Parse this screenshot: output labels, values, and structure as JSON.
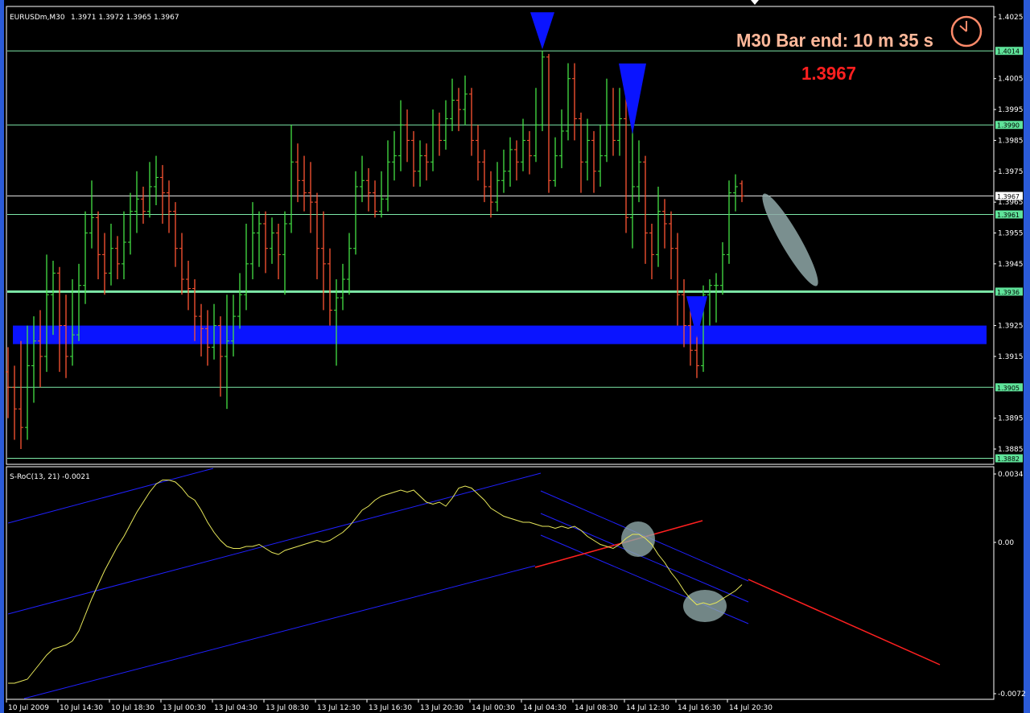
{
  "header": {
    "symbol": "EURUSDm,M30",
    "ohlc": "1.3971 1.3972 1.3965 1.3967"
  },
  "overlay": {
    "bar_end": "M30 Bar end: 10 m 35 s",
    "price": "1.3967",
    "clock_icon": "clock-icon",
    "text_color": "#ffb89a",
    "price_color": "#ff2020"
  },
  "indicator": {
    "label": "S-RoC(13, 21) -0.0021",
    "ticks": [
      "0.0034",
      "0.00",
      "-0.0072"
    ]
  },
  "colors": {
    "up": "#44e244",
    "down": "#ff5533",
    "level": "#7de8a8",
    "current": "#e0e0e0",
    "zone": "#0a14ff",
    "arrow": "#0a14ff",
    "indicator_line": "#e8e85a",
    "channel": "#2020ff",
    "trend_red": "#ff2020"
  },
  "chart_data": [
    {
      "type": "ohlc-bar",
      "symbol": "EURUSDm",
      "timeframe": "M30",
      "ylim": [
        1.388,
        1.403
      ],
      "price_ticks": [
        "1.4025",
        "1.4005",
        "1.3995",
        "1.3985",
        "1.3975",
        "1.3965",
        "1.3955",
        "1.3945",
        "1.3925",
        "1.3915",
        "1.3895",
        "1.3885"
      ],
      "x_tick_labels": [
        "10 Jul 2009",
        "10 Jul 14:30",
        "10 Jul 18:30",
        "13 Jul 00:30",
        "13 Jul 04:30",
        "13 Jul 08:30",
        "13 Jul 12:30",
        "13 Jul 16:30",
        "13 Jul 20:30",
        "14 Jul 00:30",
        "14 Jul 04:30",
        "14 Jul 08:30",
        "14 Jul 12:30",
        "14 Jul 16:30",
        "14 Jul 20:30"
      ],
      "levels": [
        {
          "price": "1.4014",
          "kind": "level"
        },
        {
          "price": "1.3990",
          "kind": "level"
        },
        {
          "price": "1.3967",
          "kind": "current"
        },
        {
          "price": "1.3961",
          "kind": "level"
        },
        {
          "price": "1.3936",
          "kind": "level-strong"
        },
        {
          "price": "1.3905",
          "kind": "level"
        },
        {
          "price": "1.3882",
          "kind": "level"
        }
      ],
      "zone": [
        1.3919,
        1.3925
      ],
      "down_arrows_at_bar": [
        83,
        97,
        107
      ],
      "bars_ohlc": [
        [
          1.391,
          1.3918,
          1.3895,
          1.3905
        ],
        [
          1.3905,
          1.3912,
          1.3888,
          1.3898
        ],
        [
          1.3898,
          1.392,
          1.3885,
          1.3892
        ],
        [
          1.3892,
          1.3925,
          1.3888,
          1.3912
        ],
        [
          1.3912,
          1.3928,
          1.39,
          1.392
        ],
        [
          1.392,
          1.393,
          1.3905,
          1.3915
        ],
        [
          1.3915,
          1.3948,
          1.391,
          1.3935
        ],
        [
          1.3935,
          1.3946,
          1.3922,
          1.3942
        ],
        [
          1.3942,
          1.3944,
          1.391,
          1.3925
        ],
        [
          1.3925,
          1.3935,
          1.3908,
          1.3915
        ],
        [
          1.3915,
          1.394,
          1.3912,
          1.3922
        ],
        [
          1.3922,
          1.3945,
          1.392,
          1.3938
        ],
        [
          1.3938,
          1.3962,
          1.3932,
          1.3955
        ],
        [
          1.3955,
          1.3972,
          1.395,
          1.396
        ],
        [
          1.396,
          1.3962,
          1.394,
          1.3948
        ],
        [
          1.3948,
          1.3955,
          1.3935,
          1.3942
        ],
        [
          1.3942,
          1.3958,
          1.3938,
          1.395
        ],
        [
          1.395,
          1.3954,
          1.394,
          1.3945
        ],
        [
          1.3945,
          1.3962,
          1.394,
          1.3952
        ],
        [
          1.3952,
          1.3968,
          1.3948,
          1.3962
        ],
        [
          1.3962,
          1.3975,
          1.3955,
          1.3966
        ],
        [
          1.3966,
          1.397,
          1.3958,
          1.3962
        ],
        [
          1.3962,
          1.3978,
          1.396,
          1.397
        ],
        [
          1.397,
          1.398,
          1.3964,
          1.3973
        ],
        [
          1.3973,
          1.3977,
          1.3958,
          1.3968
        ],
        [
          1.3968,
          1.3972,
          1.3955,
          1.3962
        ],
        [
          1.3962,
          1.3965,
          1.3944,
          1.395
        ],
        [
          1.395,
          1.3955,
          1.3935,
          1.394
        ],
        [
          1.394,
          1.3946,
          1.393,
          1.3937
        ],
        [
          1.3937,
          1.394,
          1.392,
          1.3928
        ],
        [
          1.3928,
          1.3932,
          1.3915,
          1.3924
        ],
        [
          1.3924,
          1.393,
          1.3912,
          1.3918
        ],
        [
          1.3918,
          1.3932,
          1.3914,
          1.3925
        ],
        [
          1.3925,
          1.3928,
          1.3902,
          1.3915
        ],
        [
          1.3915,
          1.3935,
          1.3898,
          1.392
        ],
        [
          1.392,
          1.3935,
          1.3915,
          1.3928
        ],
        [
          1.3928,
          1.3942,
          1.3924,
          1.3935
        ],
        [
          1.3935,
          1.3958,
          1.393,
          1.3945
        ],
        [
          1.3945,
          1.3965,
          1.394,
          1.3955
        ],
        [
          1.3955,
          1.3962,
          1.3944,
          1.3958
        ],
        [
          1.3958,
          1.3962,
          1.3942,
          1.395
        ],
        [
          1.395,
          1.396,
          1.3945,
          1.3955
        ],
        [
          1.3955,
          1.3958,
          1.394,
          1.3948
        ],
        [
          1.3948,
          1.3962,
          1.3935,
          1.3958
        ],
        [
          1.3958,
          1.399,
          1.3955,
          1.3978
        ],
        [
          1.3978,
          1.3984,
          1.3965,
          1.3972
        ],
        [
          1.3972,
          1.398,
          1.3962,
          1.3968
        ],
        [
          1.3968,
          1.3978,
          1.3955,
          1.3965
        ],
        [
          1.3965,
          1.3968,
          1.394,
          1.395
        ],
        [
          1.395,
          1.3962,
          1.393,
          1.3945
        ],
        [
          1.3945,
          1.395,
          1.3925,
          1.393
        ],
        [
          1.393,
          1.394,
          1.3912,
          1.3934
        ],
        [
          1.3934,
          1.3945,
          1.393,
          1.394
        ],
        [
          1.394,
          1.3955,
          1.3935,
          1.395
        ],
        [
          1.395,
          1.3975,
          1.3948,
          1.397
        ],
        [
          1.397,
          1.398,
          1.3965,
          1.3972
        ],
        [
          1.3972,
          1.3976,
          1.3962,
          1.3968
        ],
        [
          1.3968,
          1.3972,
          1.396,
          1.3962
        ],
        [
          1.3962,
          1.3975,
          1.396,
          1.3966
        ],
        [
          1.3966,
          1.3985,
          1.3962,
          1.3978
        ],
        [
          1.3978,
          1.3988,
          1.3972,
          1.398
        ],
        [
          1.398,
          1.3998,
          1.3975,
          1.399
        ],
        [
          1.399,
          1.3995,
          1.3978,
          1.3985
        ],
        [
          1.3985,
          1.3988,
          1.397,
          1.3975
        ],
        [
          1.3975,
          1.3985,
          1.397,
          1.398
        ],
        [
          1.398,
          1.3984,
          1.3972,
          1.3978
        ],
        [
          1.3978,
          1.3995,
          1.3975,
          1.399
        ],
        [
          1.399,
          1.3994,
          1.398,
          1.3985
        ],
        [
          1.3985,
          1.3998,
          1.3982,
          1.3992
        ],
        [
          1.3992,
          1.4005,
          1.3988,
          1.3998
        ],
        [
          1.3998,
          1.4002,
          1.3988,
          1.3995
        ],
        [
          1.3995,
          1.4006,
          1.399,
          1.4
        ],
        [
          1.4,
          1.4002,
          1.398,
          1.3985
        ],
        [
          1.3985,
          1.399,
          1.3972,
          1.3978
        ],
        [
          1.3978,
          1.3982,
          1.3965,
          1.397
        ],
        [
          1.397,
          1.3975,
          1.396,
          1.3965
        ],
        [
          1.3965,
          1.3978,
          1.3962,
          1.3972
        ],
        [
          1.3972,
          1.3982,
          1.3968,
          1.3975
        ],
        [
          1.3975,
          1.3986,
          1.397,
          1.3982
        ],
        [
          1.3982,
          1.3985,
          1.3972,
          1.3978
        ],
        [
          1.3978,
          1.3992,
          1.3975,
          1.3985
        ],
        [
          1.3985,
          1.3988,
          1.3974,
          1.398
        ],
        [
          1.398,
          1.4002,
          1.3978,
          1.399
        ],
        [
          1.399,
          1.4014,
          1.3988,
          1.4012
        ],
        [
          1.4012,
          1.4013,
          1.3968,
          1.3972
        ],
        [
          1.3972,
          1.3986,
          1.397,
          1.398
        ],
        [
          1.398,
          1.3995,
          1.3976,
          1.3988
        ],
        [
          1.3988,
          1.401,
          1.3985,
          1.4005
        ],
        [
          1.4005,
          1.401,
          1.3985,
          1.3992
        ],
        [
          1.3992,
          1.3994,
          1.3968,
          1.3978
        ],
        [
          1.3978,
          1.3992,
          1.3972,
          1.3985
        ],
        [
          1.3985,
          1.3988,
          1.3968,
          1.3975
        ],
        [
          1.3975,
          1.399,
          1.397,
          1.398
        ],
        [
          1.398,
          1.4005,
          1.3978,
          1.399
        ],
        [
          1.399,
          1.4002,
          1.398,
          1.3985
        ],
        [
          1.3985,
          1.4002,
          1.398,
          1.3992
        ],
        [
          1.3992,
          1.4,
          1.3955,
          1.396
        ],
        [
          1.396,
          1.3988,
          1.395,
          1.397
        ],
        [
          1.397,
          1.3985,
          1.3965,
          1.3978
        ],
        [
          1.3978,
          1.398,
          1.3945,
          1.3955
        ],
        [
          1.3955,
          1.3958,
          1.394,
          1.3948
        ],
        [
          1.3948,
          1.397,
          1.3944,
          1.3962
        ],
        [
          1.3962,
          1.3966,
          1.395,
          1.3958
        ],
        [
          1.3958,
          1.3962,
          1.394,
          1.395
        ],
        [
          1.395,
          1.3955,
          1.3925,
          1.3935
        ],
        [
          1.3935,
          1.394,
          1.3918,
          1.3925
        ],
        [
          1.3925,
          1.393,
          1.3912,
          1.3917
        ],
        [
          1.3917,
          1.3922,
          1.3908,
          1.3912
        ],
        [
          1.3912,
          1.3938,
          1.391,
          1.3935
        ],
        [
          1.3935,
          1.394,
          1.3925,
          1.3938
        ],
        [
          1.3938,
          1.3942,
          1.3926,
          1.3938
        ],
        [
          1.3938,
          1.3952,
          1.3935,
          1.3948
        ],
        [
          1.3948,
          1.3972,
          1.3945,
          1.3968
        ],
        [
          1.3968,
          1.3974,
          1.3962,
          1.397
        ],
        [
          1.3971,
          1.3972,
          1.3965,
          1.3967
        ]
      ]
    },
    {
      "type": "line",
      "name": "S-RoC(13, 21)",
      "ylim": [
        -0.0072,
        0.0034
      ],
      "values": [
        -0.007,
        -0.007,
        -0.0069,
        -0.0068,
        -0.0064,
        -0.006,
        -0.0056,
        -0.0053,
        -0.0052,
        -0.0051,
        -0.0049,
        -0.0044,
        -0.0036,
        -0.0028,
        -0.0021,
        -0.0014,
        -0.0008,
        -0.0002,
        0.0003,
        0.0009,
        0.0015,
        0.002,
        0.0025,
        0.0029,
        0.0031,
        0.0031,
        0.003,
        0.0027,
        0.0023,
        0.0021,
        0.0016,
        0.001,
        0.0005,
        0.0001,
        -0.0002,
        -0.0003,
        -0.0003,
        -0.0002,
        -0.0002,
        -0.0001,
        -0.0003,
        -0.0005,
        -0.0006,
        -0.0004,
        -0.0003,
        -0.0002,
        -0.0001,
        0.0,
        0.0001,
        0.0,
        0.0001,
        0.0003,
        0.0005,
        0.0008,
        0.0012,
        0.0016,
        0.0018,
        0.0021,
        0.0023,
        0.0024,
        0.0025,
        0.0026,
        0.0025,
        0.0026,
        0.0023,
        0.002,
        0.0019,
        0.002,
        0.0018,
        0.0022,
        0.0027,
        0.0028,
        0.0027,
        0.0024,
        0.0021,
        0.0017,
        0.0015,
        0.0013,
        0.0012,
        0.0011,
        0.001,
        0.001,
        0.0009,
        0.0008,
        0.0008,
        0.0007,
        0.0008,
        0.0007,
        0.0008,
        0.0006,
        0.0003,
        0.0001,
        -0.0001,
        -0.0002,
        -0.0003,
        -0.0001,
        0.0002,
        0.0004,
        0.0004,
        0.0002,
        -0.0001,
        -0.0006,
        -0.001,
        -0.0015,
        -0.0019,
        -0.0024,
        -0.0028,
        -0.0031,
        -0.003,
        -0.0031,
        -0.003,
        -0.0028,
        -0.0026,
        -0.0024,
        -0.0021
      ]
    }
  ]
}
